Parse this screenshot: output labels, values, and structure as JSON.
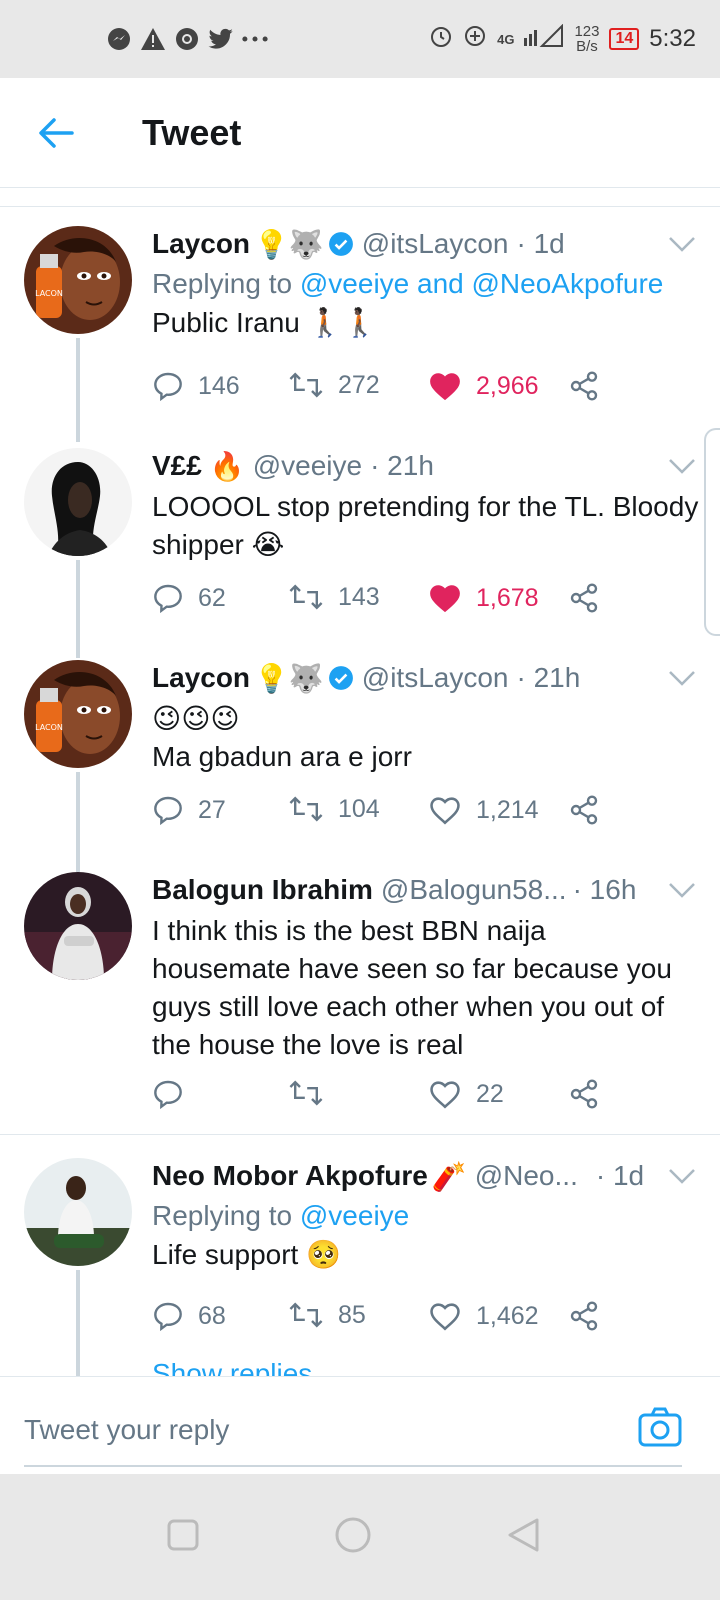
{
  "status_bar": {
    "left_icons": [
      "messenger-icon",
      "warning-icon",
      "chrome-icon",
      "twitter-icon",
      "more-dots-icon"
    ],
    "network": "4G",
    "speed_value": "123",
    "speed_unit": "B/s",
    "battery": "14",
    "time": "5:32"
  },
  "header": {
    "title": "Tweet"
  },
  "tweets": [
    {
      "name": "Laycon",
      "badges": "💡🐺",
      "verified": true,
      "handle": "@itsLaycon",
      "time": "· 1d",
      "replying_label": "Replying to",
      "replying_links": "@veeiye and @NeoAkpofure",
      "text": "Public Iranu 🚶🏿🚶🏿",
      "replies": "146",
      "retweets": "272",
      "likes": "2,966",
      "liked": true
    },
    {
      "name": "V££",
      "badges": "🔥",
      "verified": false,
      "handle": "@veeiye",
      "time": "· 21h",
      "text": "LOOOOL stop pretending for the TL. Bloody shipper 😭",
      "replies": "62",
      "retweets": "143",
      "likes": "1,678",
      "liked": true
    },
    {
      "name": "Laycon",
      "badges": "💡🐺",
      "verified": true,
      "handle": "@itsLaycon",
      "time": "· 21h",
      "text": "😉😉😉\nMa gbadun ara e jorr",
      "replies": "27",
      "retweets": "104",
      "likes": "1,214",
      "liked": false
    },
    {
      "name": "Balogun Ibrahim",
      "badges": "",
      "verified": false,
      "handle": "@Balogun58...",
      "time": "· 16h",
      "text": "I think this is the best BBN naija housemate have seen so far because you guys still love each other when you out of the house the love is real",
      "replies": "",
      "retweets": "",
      "likes": "22",
      "liked": false
    },
    {
      "name": "Neo Mobor Akpofure",
      "badges": "🧨",
      "verified": false,
      "handle": "@Neo...",
      "time": "· 1d",
      "replying_label": "Replying to",
      "replying_links": "@veeiye",
      "text": "Life support 🥺",
      "replies": "68",
      "retweets": "85",
      "likes": "1,462",
      "liked": false
    }
  ],
  "show_replies": "Show replies",
  "reply_bar": {
    "placeholder": "Tweet your reply"
  },
  "colors": {
    "accent": "#1da1f2",
    "like": "#e0245e",
    "muted": "#657786"
  }
}
